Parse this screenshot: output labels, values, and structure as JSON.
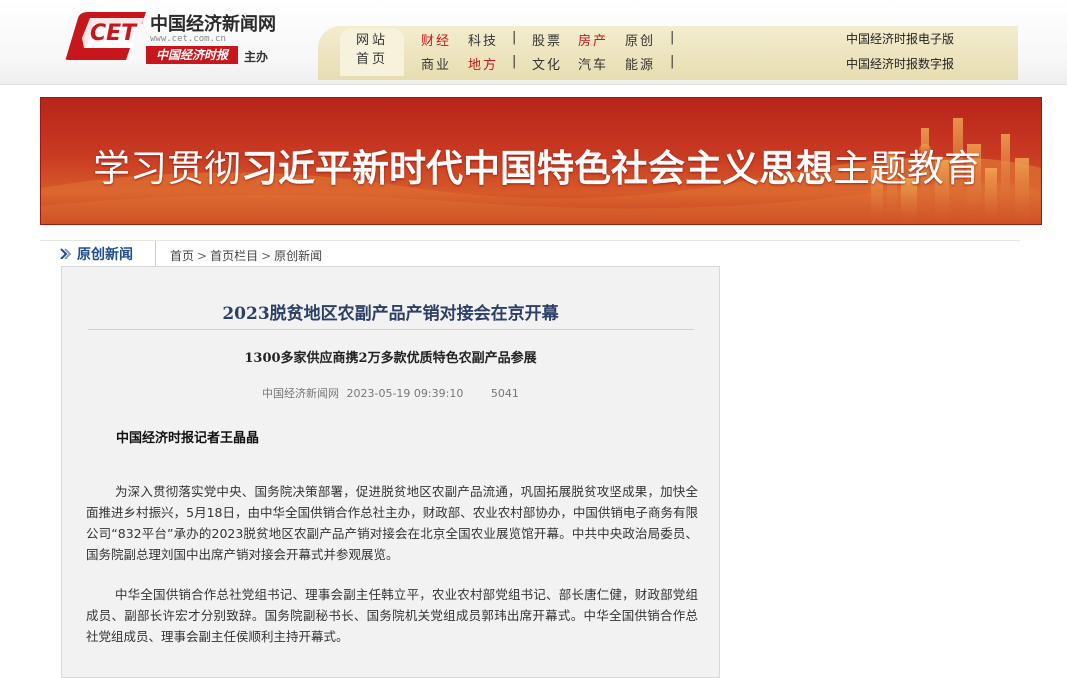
{
  "header": {
    "site_name": "中国经济新闻网",
    "site_url": "www.cet.com.cn",
    "paper_name": "中国经济时报",
    "host_label": "主办",
    "nav_home": [
      "网站",
      "首页"
    ],
    "nav_row1": [
      {
        "label": "财经",
        "color": "#c8161d"
      },
      {
        "label": "科技",
        "color": "#333333"
      },
      {
        "label": "股票",
        "color": "#333333"
      },
      {
        "label": "房产",
        "color": "#c8161d"
      },
      {
        "label": "原创",
        "color": "#333333"
      }
    ],
    "nav_row2": [
      {
        "label": "商业",
        "color": "#333333"
      },
      {
        "label": "地方",
        "color": "#c8161d"
      },
      {
        "label": "文化",
        "color": "#333333"
      },
      {
        "label": "汽车",
        "color": "#333333"
      },
      {
        "label": "能源",
        "color": "#333333"
      }
    ],
    "separator": "|",
    "edition_links": [
      "中国经济时报电子版",
      "中国经济时报数字报"
    ]
  },
  "banner": {
    "text_regular": "学习贯彻",
    "text_bold": "习近平新时代中国特色社会主义思想",
    "text_tail": "主题教育"
  },
  "section": {
    "title": "原创新闻",
    "breadcrumb": [
      "首页",
      "首页栏目",
      "原创新闻"
    ],
    "breadcrumb_sep": ">"
  },
  "article": {
    "title": "2023脱贫地区农副产品产销对接会在京开幕",
    "subtitle": "1300多家供应商携2万多款优质特色农副产品参展",
    "source": "中国经济新闻网",
    "datetime": "2023-05-19 09:39:10",
    "views": "5041",
    "byline": "中国经济时报记者王晶晶",
    "paragraphs": [
      "为深入贯彻落实党中央、国务院决策部署，促进脱贫地区农副产品流通，巩固拓展脱贫攻坚成果，加快全面推进乡村振兴，5月18日，由中华全国供销合作总社主办，财政部、农业农村部协办，中国供销电子商务有限公司“832平台”承办的2023脱贫地区农副产品产销对接会在北京全国农业展览馆开幕。中共中央政治局委员、国务院副总理刘国中出席产销对接会开幕式并参观展览。",
      "中华全国供销合作总社党组书记、理事会副主任韩立平，农业农村部党组书记、部长唐仁健，财政部党组成员、副部长许宏才分别致辞。国务院副秘书长、国务院机关党组成员郭玮出席开幕式。中华全国供销合作总社党组成员、理事会副主任侯顺利主持开幕式。"
    ]
  },
  "colors": {
    "brand_red": "#c8161d",
    "section_blue": "#1f4e8c",
    "title_navy": "#2c3f66"
  }
}
